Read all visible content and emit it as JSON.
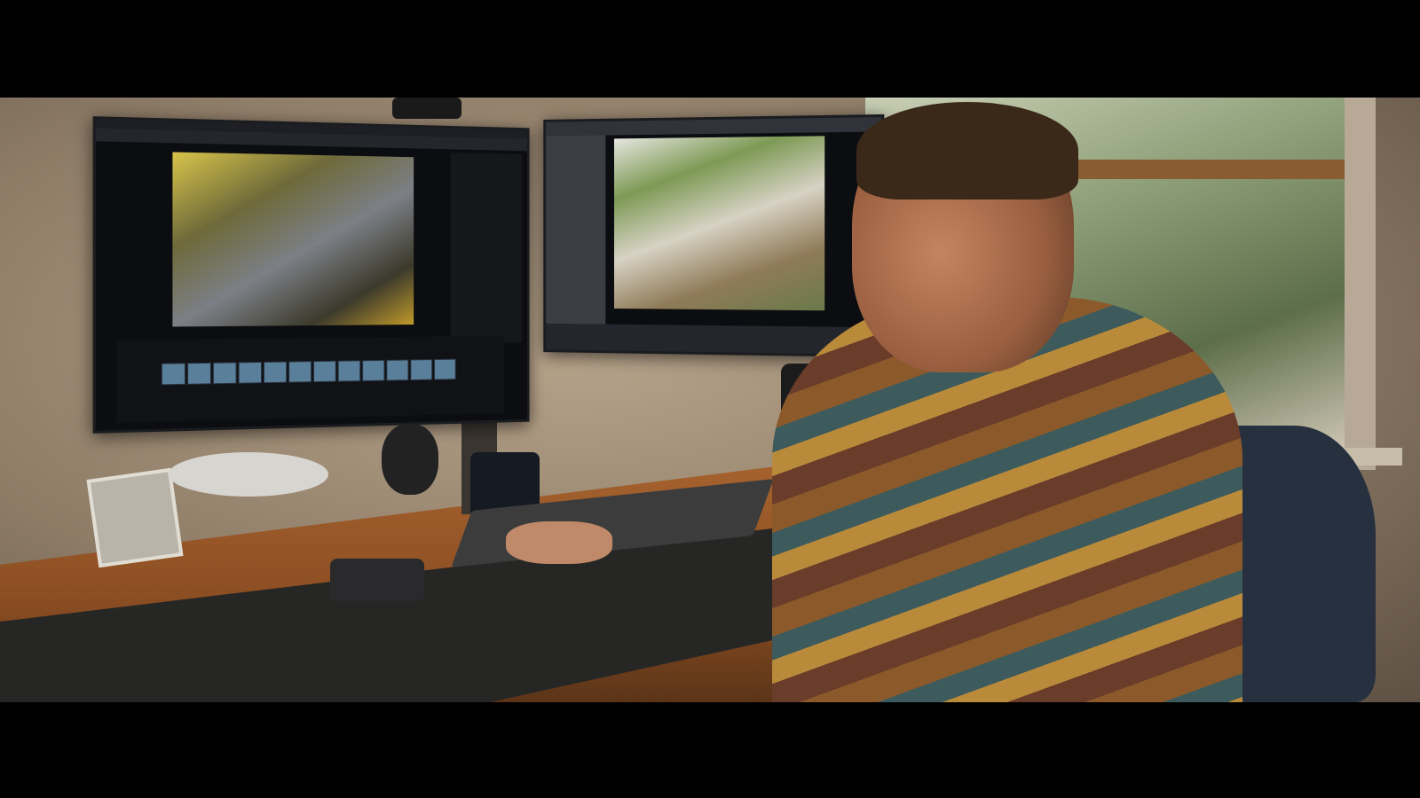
{
  "scene": {
    "colors": {
      "letterbox": "#000000",
      "desk_wood": "#9a5a2a",
      "jacket_primary": "#8c5a2a",
      "monitor_bezel": "#0c0d10"
    },
    "elements": [
      "person-at-desk",
      "left-monitor-video-editor",
      "right-monitor-photo-viewer",
      "mechanical-keyboard",
      "stream-deck-controller",
      "smart-speaker",
      "desk-lamp",
      "photo-frame",
      "office-chair",
      "window-with-greenery"
    ]
  }
}
